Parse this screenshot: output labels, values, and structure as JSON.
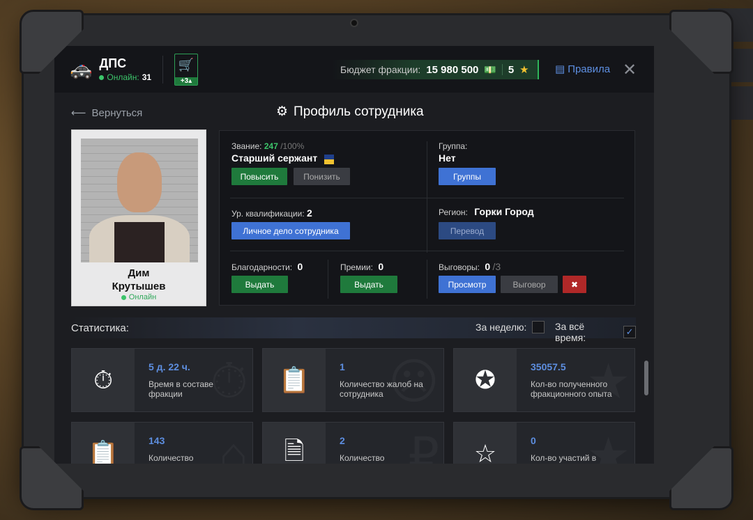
{
  "header": {
    "faction_icon": "police-car-icon",
    "faction_name": "ДПС",
    "online_label": "Онлайн:",
    "online_count": "31",
    "cart_badge": "+3",
    "budget_label": "Бюджет фракции:",
    "budget_value": "15 980 500",
    "stars_value": "5",
    "rules_label": "Правила"
  },
  "profile": {
    "back_label": "Вернуться",
    "title": "Профиль сотрудника",
    "name_first": "Дим",
    "name_last": "Крутышев",
    "status": "Онлайн"
  },
  "info": {
    "rank_label": "Звание:",
    "rank_points": "247",
    "rank_max": "/100%",
    "rank_name": "Старший сержант",
    "promote_label": "Повысить",
    "demote_label": "Понизить",
    "group_label": "Группа:",
    "group_value": "Нет",
    "groups_button": "Группы",
    "qual_label": "Ур. квалификации:",
    "qual_value": "2",
    "personal_file_button": "Личное дело сотрудника",
    "region_label": "Регион:",
    "region_value": "Горки Город",
    "transfer_button": "Перевод",
    "thanks_label": "Благодарности:",
    "thanks_value": "0",
    "thanks_button": "Выдать",
    "bonus_label": "Премии:",
    "bonus_value": "0",
    "bonus_button": "Выдать",
    "reprimand_label": "Выговоры:",
    "reprimand_value": "0",
    "reprimand_max": "/3",
    "view_button": "Просмотр",
    "reprimand_button": "Выговор"
  },
  "statistics": {
    "title": "Статистика:",
    "week_label": "За неделю:",
    "week_checked": false,
    "all_time_label": "За всё время:",
    "all_time_checked": true,
    "tiles": [
      {
        "icon": "stopwatch-icon",
        "value": "5 д. 22 ч.",
        "desc": "Время в составе фракции"
      },
      {
        "icon": "complaint-icon",
        "value": "1",
        "desc": "Количество жалоб на сотрудника"
      },
      {
        "icon": "exp-stars-icon",
        "value": "35057.5",
        "desc": "Кол-во полученного фракционного опыта"
      },
      {
        "icon": "clipboard-icon",
        "value": "143",
        "desc": "Количество"
      },
      {
        "icon": "money-document-icon",
        "value": "2",
        "desc": "Количество"
      },
      {
        "icon": "star-podium-icon",
        "value": "0",
        "desc": "Кол-во участий в"
      }
    ]
  },
  "colors": {
    "accent_blue": "#3f72d4",
    "accent_green": "#1f7a3c",
    "danger_red": "#b02828",
    "value_blue": "#5d8ee0"
  }
}
